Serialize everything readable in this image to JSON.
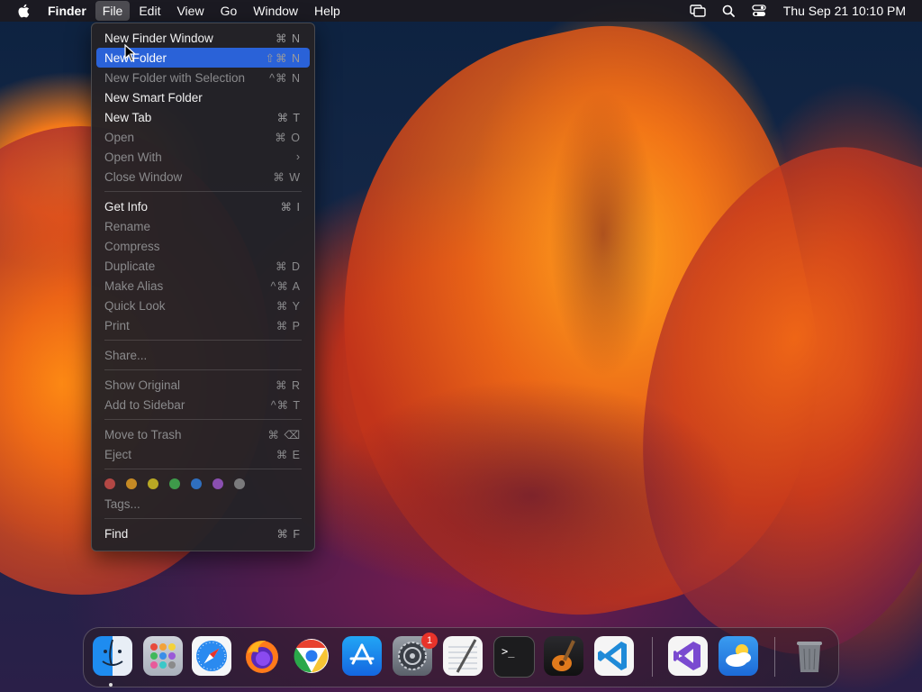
{
  "menubar": {
    "app_name": "Finder",
    "menus": [
      "File",
      "Edit",
      "View",
      "Go",
      "Window",
      "Help"
    ],
    "active_menu": "File",
    "clock": "Thu Sep 21  10:10 PM"
  },
  "file_menu": {
    "items": [
      {
        "label": "New Finder Window",
        "shortcut": "⌘ N"
      },
      {
        "label": "New Folder",
        "shortcut": "⇧⌘ N"
      },
      {
        "label": "New Folder with Selection",
        "shortcut": "^⌘ N"
      },
      {
        "label": "New Smart Folder",
        "shortcut": ""
      },
      {
        "label": "New Tab",
        "shortcut": "⌘ T"
      },
      {
        "label": "Open",
        "shortcut": "⌘ O"
      },
      {
        "label": "Open With",
        "shortcut": "›"
      },
      {
        "label": "Close Window",
        "shortcut": "⌘ W"
      },
      {
        "label": "Get Info",
        "shortcut": "⌘ I"
      },
      {
        "label": "Rename",
        "shortcut": ""
      },
      {
        "label": "Compress",
        "shortcut": ""
      },
      {
        "label": "Duplicate",
        "shortcut": "⌘ D"
      },
      {
        "label": "Make Alias",
        "shortcut": "^⌘ A"
      },
      {
        "label": "Quick Look",
        "shortcut": "⌘ Y"
      },
      {
        "label": "Print",
        "shortcut": "⌘ P"
      },
      {
        "label": "Share...",
        "shortcut": ""
      },
      {
        "label": "Show Original",
        "shortcut": "⌘ R"
      },
      {
        "label": "Add to Sidebar",
        "shortcut": "^⌘ T"
      },
      {
        "label": "Move to Trash",
        "shortcut": "⌘ ⌫"
      },
      {
        "label": "Eject",
        "shortcut": "⌘ E"
      },
      {
        "label": "Tags...",
        "shortcut": ""
      },
      {
        "label": "Find",
        "shortcut": "⌘ F"
      }
    ],
    "highlighted": "New Folder",
    "tag_colors": [
      "#b34744",
      "#c68a24",
      "#b8a824",
      "#3e9a4a",
      "#2f6fbf",
      "#8a4fb0",
      "#7a7a7c"
    ]
  },
  "dock": {
    "apps": [
      "finder-icon",
      "launchpad-icon",
      "safari-icon",
      "firefox-icon",
      "chrome-icon",
      "app-store-icon",
      "system-settings-icon",
      "textedit-icon",
      "terminal-icon",
      "garageband-icon",
      "vscode-icon",
      "visual-studio-icon",
      "weather-icon",
      "trash-icon"
    ],
    "settings_badge": "1"
  }
}
